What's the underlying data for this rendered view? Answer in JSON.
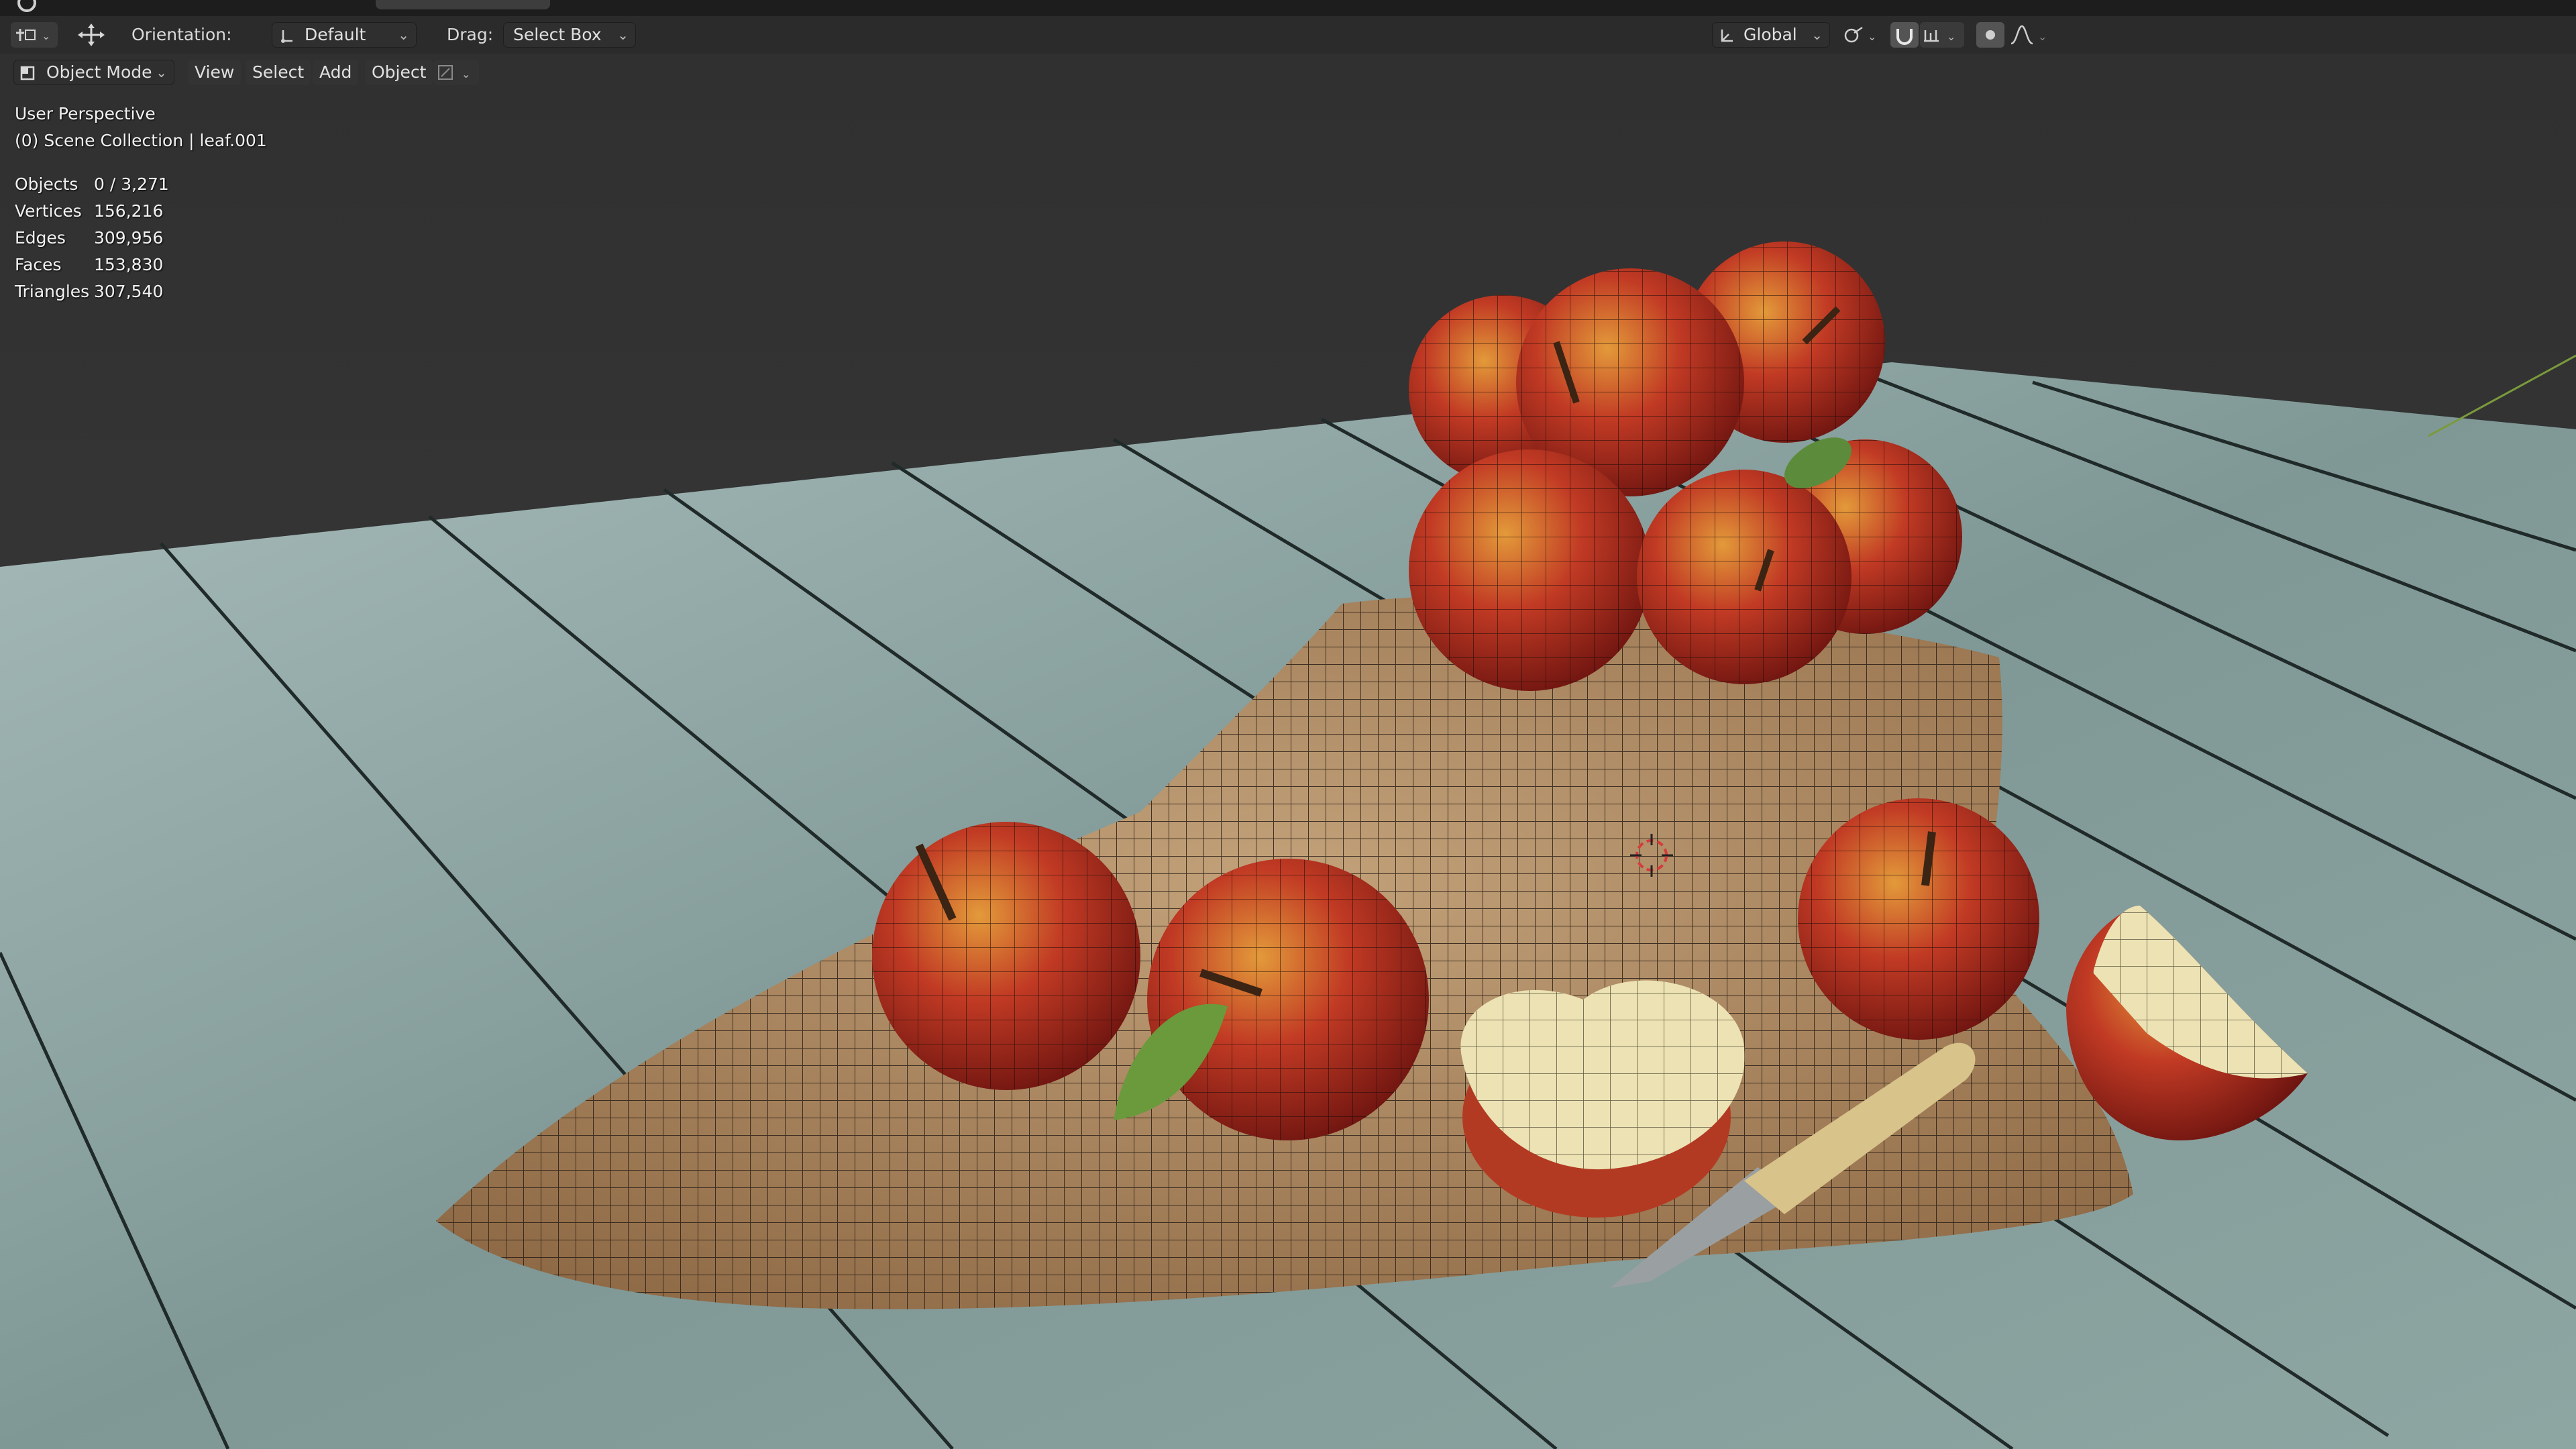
{
  "topbar": {
    "visible": "partial"
  },
  "header": {
    "orientation_label": "Orientation:",
    "orientation_value": "Default",
    "drag_label": "Drag:",
    "drag_value": "Select Box",
    "transform_space": "Global"
  },
  "view_header": {
    "mode": "Object Mode",
    "menus": [
      "View",
      "Select",
      "Add",
      "Object"
    ]
  },
  "overlay": {
    "perspective": "User Perspective",
    "collection": "(0) Scene Collection | leaf.001"
  },
  "stats": [
    {
      "key": "Objects",
      "value": "0 / 3,271"
    },
    {
      "key": "Vertices",
      "value": "156,216"
    },
    {
      "key": "Edges",
      "value": "309,956"
    },
    {
      "key": "Faces",
      "value": "153,830"
    },
    {
      "key": "Triangles",
      "value": "307,540"
    }
  ],
  "colors": {
    "header_bg": "#2b2b2b",
    "viewport_bg": "#3a3a3a",
    "table": "#8fa7a4",
    "apple_red": "#b32c22",
    "burlap": "#b08a63"
  },
  "icons": [
    "transform-tool-icon",
    "move-gizmo-icon",
    "orientation-icon",
    "global-axes-icon",
    "snap-link-icon",
    "snap-magnet-icon",
    "snap-increment-icon",
    "proportional-edit-icon",
    "falloff-curve-icon",
    "object-mode-icon",
    "cursor-icon"
  ]
}
